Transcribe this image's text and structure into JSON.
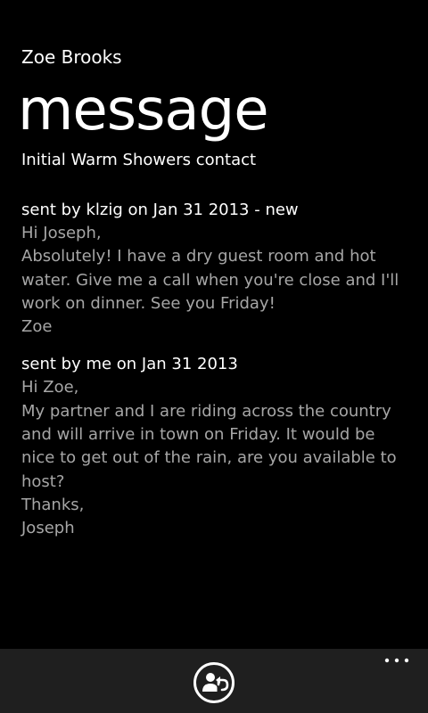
{
  "header": {
    "app_title": "Zoe Brooks",
    "page_title": "message",
    "subject": "Initial Warm Showers contact"
  },
  "messages": [
    {
      "header": "sent by klzig on Jan 31 2013 - new",
      "lines": [
        "Hi Joseph,",
        "Absolutely!  I have a dry guest room and hot",
        "water.  Give me a call when you're close and I'll",
        "work on dinner.  See you Friday!",
        "Zoe"
      ]
    },
    {
      "header": "sent by me on Jan 31 2013",
      "lines": [
        "Hi Zoe,",
        "My partner and I are riding across the country",
        "and will arrive in town on Friday.  It would be",
        "nice to get out of the rain, are you available to",
        "host?",
        "Thanks,",
        "Joseph"
      ]
    }
  ],
  "app_bar": {
    "reply_icon": "reply-icon",
    "more_icon": "more-options-icon"
  },
  "colors": {
    "background": "#000000",
    "primary_text": "#ffffff",
    "secondary_text": "#a6a6a6",
    "app_bar": "#1f1f1f"
  }
}
